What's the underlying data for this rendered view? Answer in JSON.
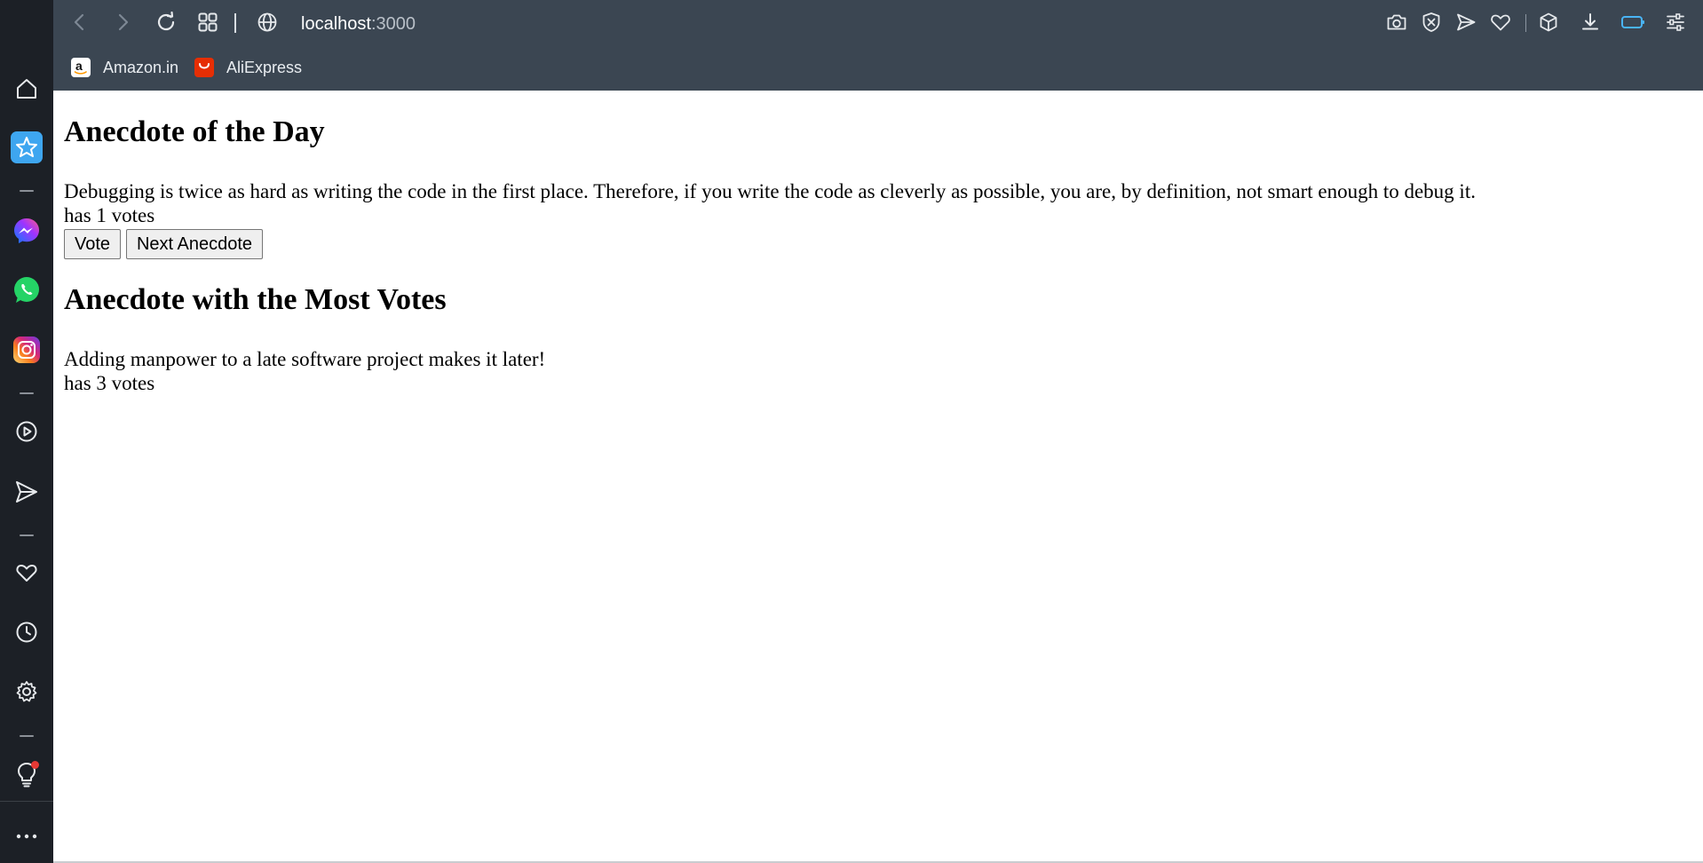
{
  "browser": {
    "address": {
      "host": "localhost",
      "port": ":3000"
    },
    "bookmarks": [
      {
        "label": "Amazon.in",
        "icon": "amazon-icon",
        "color": "#ffffff"
      },
      {
        "label": "AliExpress",
        "icon": "aliexpress-icon",
        "color": "#e62e04"
      }
    ],
    "toolbar_icons": [
      "back-icon",
      "forward-icon",
      "reload-icon",
      "tabs-grid-icon",
      "globe-icon",
      "camera-icon",
      "shield-icon",
      "send-icon",
      "heart-icon",
      "cube-icon",
      "download-icon",
      "battery-icon",
      "settings-sliders-icon"
    ]
  },
  "sidebar": {
    "icons": [
      "home-icon",
      "bookmarks-star-icon",
      "messenger-icon",
      "whatsapp-icon",
      "instagram-icon",
      "player-icon",
      "send-icon",
      "heart-icon",
      "history-clock-icon",
      "settings-gear-icon",
      "lightbulb-icon",
      "more-icon"
    ],
    "accent": "#3ea6f0",
    "notification_color": "#e53935"
  },
  "page": {
    "heading_day": "Anecdote of the Day",
    "anecdote_day": "Debugging is twice as hard as writing the code in the first place. Therefore, if you write the code as cleverly as possible, you are, by definition, not smart enough to debug it.",
    "votes_day": "has 1 votes",
    "vote_label": "Vote",
    "next_label": "Next Anecdote",
    "heading_most": "Anecdote with the Most Votes",
    "anecdote_most": "Adding manpower to a late software project makes it later!",
    "votes_most": "has 3 votes"
  }
}
